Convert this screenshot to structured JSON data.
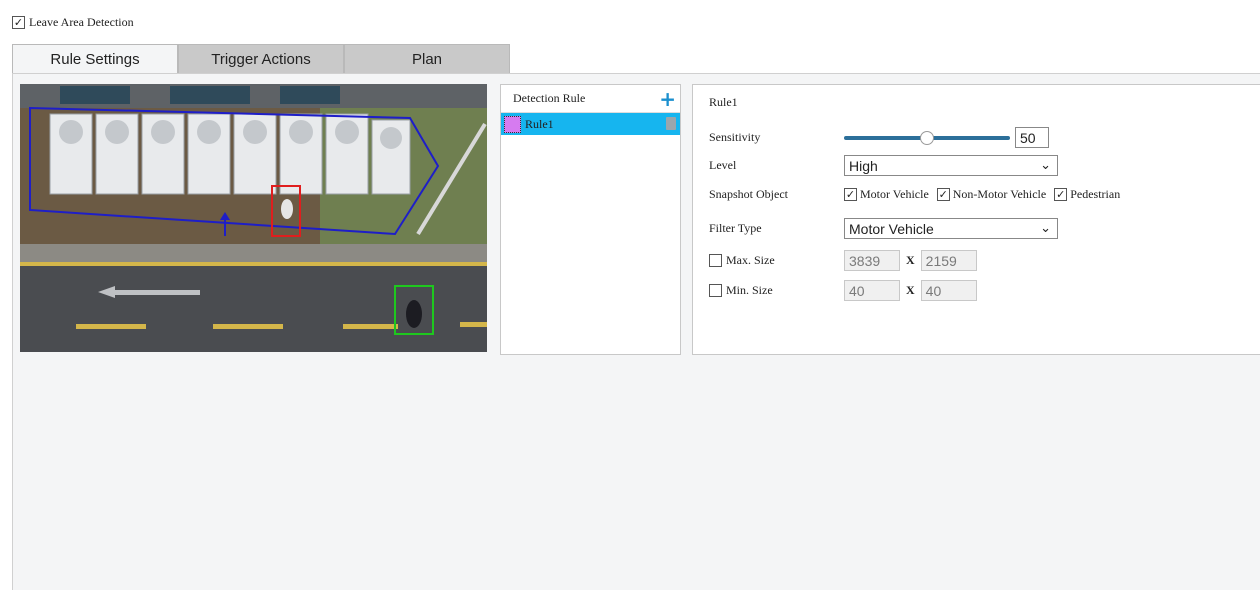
{
  "header": {
    "enable_label": "Leave Area Detection",
    "enable_checked": true
  },
  "tabs": [
    {
      "label": "Rule Settings",
      "active": true
    },
    {
      "label": "Trigger Actions",
      "active": false
    },
    {
      "label": "Plan",
      "active": false
    }
  ],
  "rule_list": {
    "title": "Detection Rule",
    "add_icon": "plus-icon",
    "items": [
      {
        "label": "Rule1",
        "color": "#d67bf0",
        "selected": true
      }
    ]
  },
  "rule": {
    "name": "Rule1",
    "sensitivity": {
      "label": "Sensitivity",
      "value": "50"
    },
    "level": {
      "label": "Level",
      "value": "High"
    },
    "snapshot": {
      "label": "Snapshot Object",
      "options": [
        {
          "label": "Motor Vehicle",
          "checked": true
        },
        {
          "label": "Non-Motor Vehicle",
          "checked": true
        },
        {
          "label": "Pedestrian",
          "checked": true
        }
      ]
    },
    "filter_type": {
      "label": "Filter Type",
      "value": "Motor Vehicle"
    },
    "max_size": {
      "label": "Max. Size",
      "checked": false,
      "w": "3839",
      "h": "2159"
    },
    "min_size": {
      "label": "Min. Size",
      "checked": false,
      "w": "40",
      "h": "40"
    },
    "x_sep": "X"
  },
  "colors": {
    "accent": "#1b8fce",
    "selected_row": "#16b5ef",
    "detection_area": "#1e1ec8",
    "target_red": "#e01e1e",
    "target_green": "#1ec81e"
  }
}
